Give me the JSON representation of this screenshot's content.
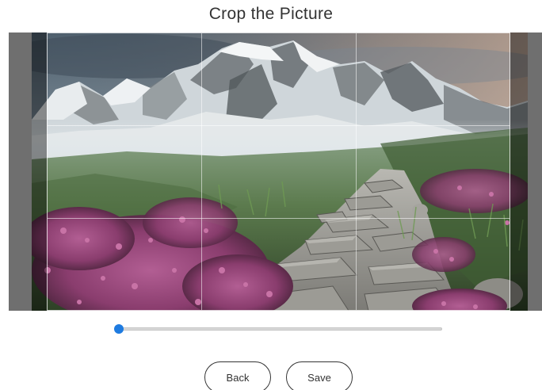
{
  "title": "Crop the Picture",
  "slider": {
    "value": 0.0
  },
  "buttons": {
    "back_label": "Back",
    "save_label": "Save"
  },
  "colors": {
    "accent": "#1e7be0",
    "stage_background": "#6f6f6f",
    "button_border": "#333333"
  }
}
